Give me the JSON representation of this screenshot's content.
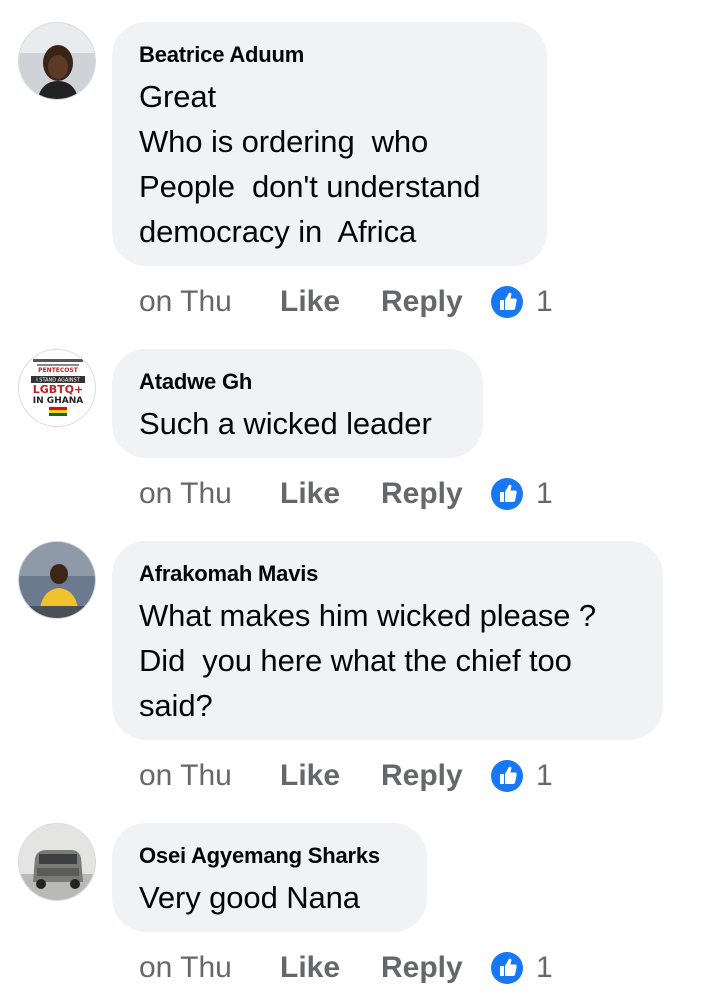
{
  "colors": {
    "bubble_bg": "#f0f2f5",
    "secondary_text": "#65676b",
    "like_blue": "#1877f2"
  },
  "comments": [
    {
      "author": "Beatrice Aduum",
      "lines": [
        "Great",
        "Who is ordering  who",
        "People  don't understand",
        "democracy in  Africa"
      ],
      "time": "on Thu",
      "like_label": "Like",
      "reply_label": "Reply",
      "reaction_icon": "thumbs-up-icon",
      "reaction_count": "1"
    },
    {
      "author": "Atadwe Gh",
      "lines": [
        "Such a wicked leader"
      ],
      "time": "on Thu",
      "like_label": "Like",
      "reply_label": "Reply",
      "reaction_icon": "thumbs-up-icon",
      "reaction_count": "1"
    },
    {
      "author": "Afrakomah Mavis",
      "lines": [
        "What makes him wicked please ?",
        "Did  you here what the chief too",
        "said?"
      ],
      "time": "on Thu",
      "like_label": "Like",
      "reply_label": "Reply",
      "reaction_icon": "thumbs-up-icon",
      "reaction_count": "1"
    },
    {
      "author": "Osei Agyemang Sharks",
      "lines": [
        "Very good Nana"
      ],
      "time": "on Thu",
      "like_label": "Like",
      "reply_label": "Reply",
      "reaction_icon": "thumbs-up-icon",
      "reaction_count": "1"
    }
  ],
  "avatars": {
    "atadwe_badge_text": [
      "PENTECOST",
      "I STAND AGAINST",
      "LGBTQ+",
      "IN GHANA"
    ]
  }
}
